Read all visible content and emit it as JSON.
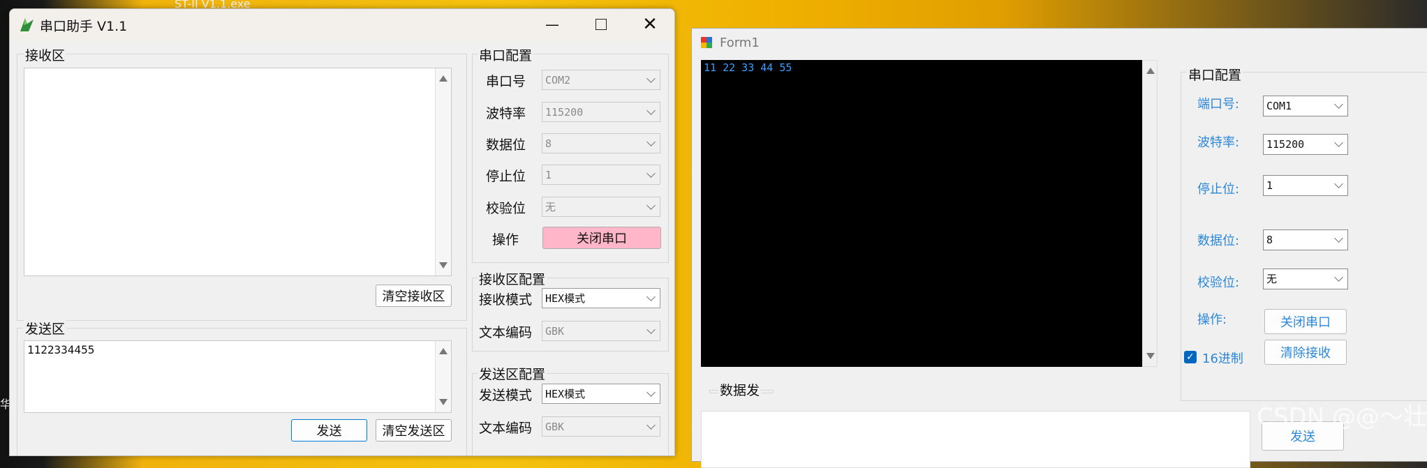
{
  "desktop": {
    "fragment_top": "ST-II          V1.1.exe",
    "fragment_left": "华"
  },
  "main_window": {
    "title": "串口助手 V1.1",
    "receive": {
      "group_label": "接收区",
      "content": "",
      "clear_label": "清空接收区"
    },
    "send": {
      "group_label": "发送区",
      "content": "1122334455",
      "send_label": "发送",
      "clear_label": "清空发送区"
    },
    "serial_config": {
      "group_label": "串口配置",
      "rows": [
        {
          "label": "串口号",
          "value": "COM2"
        },
        {
          "label": "波特率",
          "value": "115200"
        },
        {
          "label": "数据位",
          "value": "8"
        },
        {
          "label": "停止位",
          "value": "1"
        },
        {
          "label": "校验位",
          "value": "无"
        }
      ],
      "operation_label": "操作",
      "operation_button": "关闭串口",
      "operation_color": "#ffb6c8"
    },
    "receive_config": {
      "group_label": "接收区配置",
      "mode_label": "接收模式",
      "mode_value": "HEX模式",
      "encoding_label": "文本编码",
      "encoding_value": "GBK"
    },
    "send_config": {
      "group_label": "发送区配置",
      "mode_label": "发送模式",
      "mode_value": "HEX模式",
      "encoding_label": "文本编码",
      "encoding_value": "GBK"
    }
  },
  "form1": {
    "title": "Form1",
    "display_text": "11 22 33 44 55",
    "config": {
      "group_label": "串口配置",
      "rows": [
        {
          "label": "端口号:",
          "value": "COM1"
        },
        {
          "label": "波特率:",
          "value": "115200"
        },
        {
          "label": "停止位:",
          "value": "1"
        },
        {
          "label": "数据位:",
          "value": "8"
        },
        {
          "label": "校验位:",
          "value": "无"
        }
      ],
      "operation_label": "操作:",
      "close_button": "关闭串口",
      "clear_button": "清除接收",
      "hex_checkbox_label": "16进制",
      "hex_checked": true,
      "send_button": "发送"
    },
    "send_group_label": "数据发"
  },
  "watermark": "CSDN @@～壮"
}
